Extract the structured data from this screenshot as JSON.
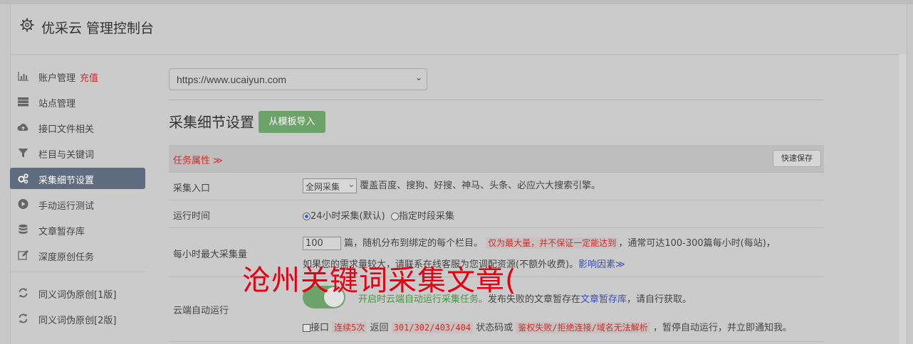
{
  "header": {
    "title": "优采云 管理控制台"
  },
  "sidebar": {
    "items": [
      {
        "label": "账户管理",
        "extra": "充值"
      },
      {
        "label": "站点管理"
      },
      {
        "label": "接口文件相关"
      },
      {
        "label": "栏目与关键词"
      },
      {
        "label": "采集细节设置"
      },
      {
        "label": "手动运行测试"
      },
      {
        "label": "文章暂存库"
      },
      {
        "label": "深度原创任务"
      },
      {
        "label": "同义词伪原创[1版]"
      },
      {
        "label": "同义词伪原创[2版]"
      }
    ]
  },
  "main": {
    "site_select": {
      "value": "https://www.ucaiyun.com"
    },
    "section_title": "采集细节设置",
    "import_button": "从模板导入",
    "table": {
      "head_label": "任务属性 ≫",
      "save_button": "快速保存",
      "rows": {
        "entry": {
          "label": "采集入口",
          "select_value": "全网采集",
          "desc": "覆盖百度、搜狗、好搜、神马、头条、必应六大搜索引擎。"
        },
        "runtime": {
          "label": "运行时间",
          "opt1": "24小时采集(默认)",
          "opt2": "指定时段采集"
        },
        "max": {
          "label": "每小时最大采集量",
          "value": "100",
          "text1": "篇，随机分布到绑定的每个栏目。",
          "warn": "仅为最大量，并不保证一定能达到",
          "text2": "，通常可达100-300篇每小时(每站)，",
          "text3": "如果您的需求量较大，请联系在线客服为您调配资源(不额外收费)。",
          "link": "影响因素≫"
        },
        "cloud": {
          "label": "云端自动运行",
          "desc1": "开启时云端自动运行采集任务。",
          "desc2": "发布失败的文章暂存在",
          "link": "文章暂存库",
          "desc3": "，请自行获取。",
          "cb_label": "接口",
          "code1": "连续5次",
          "t1": "返回",
          "code2": "301/302/403/404",
          "t2": "状态码或",
          "code3": "鉴权失败/拒绝连接/域名无法解析",
          "t3": "，暂停自动运行，并立即通知我。"
        }
      }
    }
  },
  "overlay": {
    "text": "沧州关键词采集文章("
  }
}
